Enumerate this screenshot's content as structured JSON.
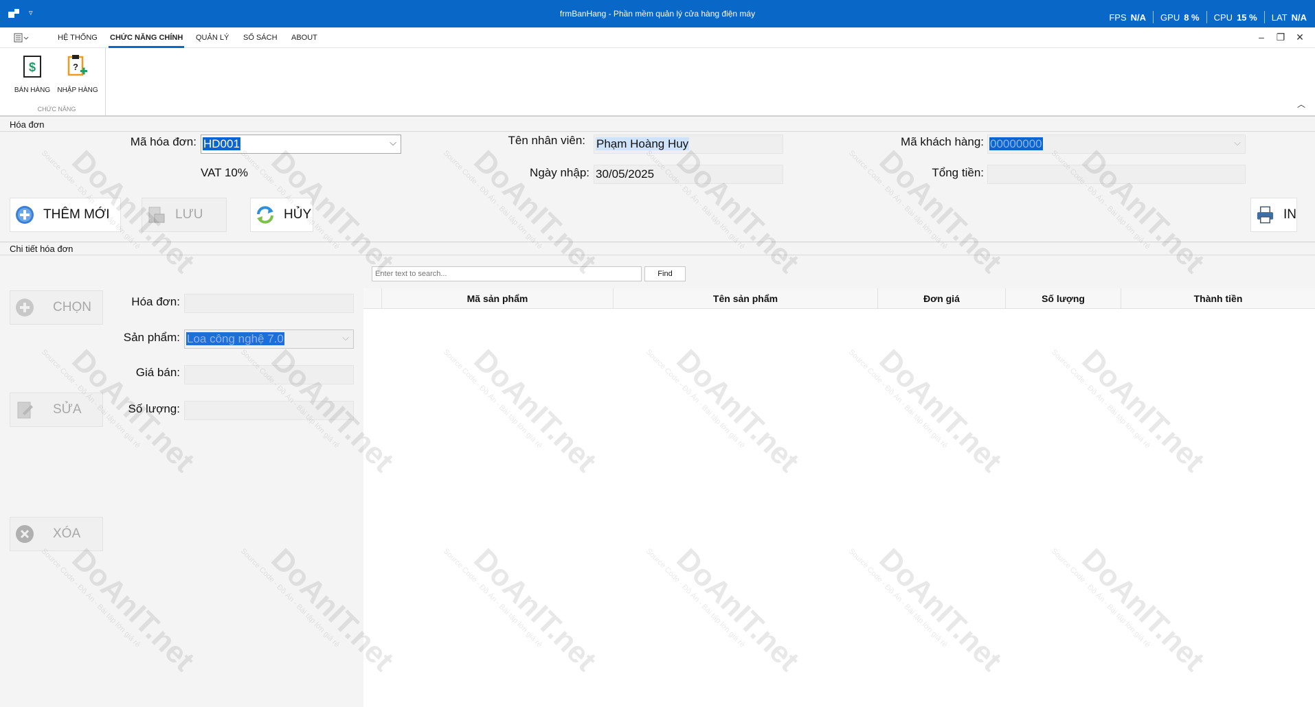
{
  "titlebar": {
    "title": "frmBanHang - Phần mềm quản lý cửa hàng điện máy",
    "quick_access": "▿",
    "stats": [
      {
        "label": "FPS",
        "value": "N/A"
      },
      {
        "label": "GPU",
        "value": "8 %"
      },
      {
        "label": "CPU",
        "value": "15 %"
      },
      {
        "label": "LAT",
        "value": "N/A"
      }
    ]
  },
  "ribbon": {
    "tabs": [
      "HỆ THỐNG",
      "CHỨC NĂNG CHÍNH",
      "QUẢN LÝ",
      "SỔ SÁCH",
      "ABOUT"
    ],
    "active_tab": "CHỨC NĂNG CHÍNH",
    "buttons": [
      "BÁN HÀNG",
      "NHẬP HÀNG"
    ],
    "group_caption": "CHỨC NĂNG",
    "window_controls": {
      "minimize": "–",
      "restore": "❐",
      "close": "✕"
    },
    "collapse": "︿"
  },
  "invoice": {
    "group_title": "Hóa đơn",
    "ma_hoa_don_label": "Mã hóa đơn:",
    "ma_hoa_don_value": "HD001",
    "vat": "VAT 10%",
    "ten_nhan_vien_label": "Tên nhân viên:",
    "ten_nhan_vien_value": "Phạm Hoàng Huy",
    "ngay_nhap_label": "Ngày nhập:",
    "ngay_nhap_value": "30/05/2025",
    "ma_khach_hang_label": "Mã khách hàng:",
    "ma_khach_hang_value": "00000000",
    "tong_tien_label": "Tổng tiền:",
    "tong_tien_value": "",
    "buttons": {
      "them_moi": "THÊM MỚI",
      "luu": "LƯU",
      "huy": "HỦY",
      "in": "IN"
    }
  },
  "detail": {
    "group_title": "Chi tiết hóa đơn",
    "buttons": {
      "chon": "CHỌN",
      "sua": "SỬA",
      "xoa": "XÓA"
    },
    "hoa_don_label": "Hóa đơn:",
    "hoa_don_value": "",
    "san_pham_label": "Sản phẩm:",
    "san_pham_value": "Loa công nghệ 7.0",
    "gia_ban_label": "Giá bán:",
    "gia_ban_value": "",
    "so_luong_label": "Số lượng:",
    "so_luong_value": "",
    "search_placeholder": "Enter text to search...",
    "find_label": "Find",
    "columns": [
      "Mã sản phẩm",
      "Tên sản phẩm",
      "Đơn giá",
      "Số lượng",
      "Thành tiền"
    ]
  },
  "watermark": {
    "brand": "DoAnIT.net",
    "tagline": "Source Code - Đồ Án - Bài tập lớn giá rẻ"
  },
  "colors": {
    "titlebar": "#0867c7",
    "selection": "#0a64d2",
    "accent_green": "#1f9c6b",
    "accent_orange": "#f29a1c"
  }
}
